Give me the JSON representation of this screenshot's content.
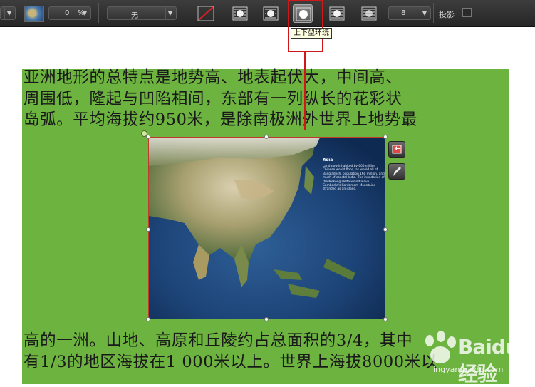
{
  "toolbar": {
    "opacity_value": "0",
    "opacity_unit": "%",
    "wrap_mode_select": "无",
    "wrap_distance": "8",
    "shadow_label": "投影",
    "wrap_buttons": [
      "none",
      "square",
      "tight",
      "top-bottom",
      "through",
      "behind"
    ],
    "active_wrap": "top-bottom"
  },
  "tooltip": {
    "text": "上下型环绕"
  },
  "document": {
    "text_top": [
      "亚洲地形的总特点是地势高、地表起伏大，中间高、",
      "周围低，隆起与凹陷相间，东部有一列纵长的花彩状",
      "岛弧。平均海拔约950米，是除南极洲外世界上地势最"
    ],
    "text_bottom": [
      "高的一洲。山地、高原和丘陵约占总面积的3/4，其中",
      "有1/3的地区海拔在1 000米以上。世界上海拔8000米以"
    ],
    "page_color": "#6db33f"
  },
  "image": {
    "caption_title": "Asia",
    "caption_text": "Land now inhabited by 600 million Chinese would flood, as would all of Bangladesh, population 160 million, and much of coastal India. The inundation of the Mekong Delta would leave Cambodia's Cardamom Mountains stranded as an island."
  },
  "watermark": {
    "brand": "Baidu经验",
    "site": "jingyan.baidu.com"
  },
  "colors": {
    "accent_red": "#d01818",
    "toolbar_bg": "#2e2e2e"
  }
}
